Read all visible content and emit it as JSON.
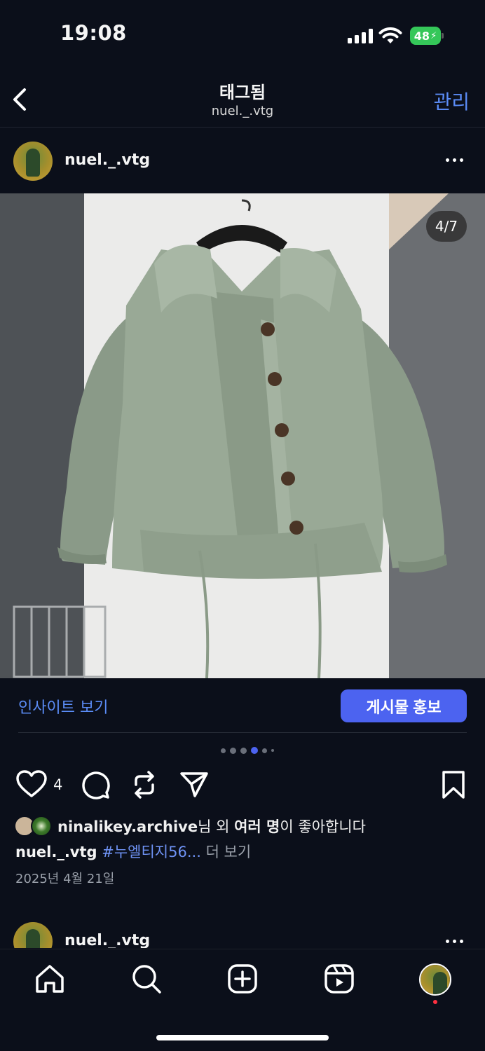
{
  "status_bar": {
    "time": "19:08",
    "battery": "48"
  },
  "header": {
    "title": "태그됨",
    "subtitle": "nuel._.vtg",
    "manage_label": "관리"
  },
  "post": {
    "username": "nuel._.vtg",
    "photo_counter": "4/7",
    "insight_label": "인사이트 보기",
    "promote_label": "게시물 홍보",
    "like_count": "4",
    "liked_by_user": "ninalikey.archive",
    "liked_by_suffix_1": "님 외 ",
    "liked_by_bold": "여러 명",
    "liked_by_suffix_2": "이 좋아합니다",
    "caption_user": "nuel._.vtg",
    "caption_hashtag": "#누엘티지56...",
    "caption_more": "더 보기",
    "date": "2025년 4월 21일"
  },
  "next_post": {
    "username": "nuel._.vtg"
  },
  "carousel": {
    "total": 6,
    "active_index": 3
  },
  "colors": {
    "accent": "#5b8cf7",
    "promote": "#4c63f0",
    "background": "#0b0f1a"
  },
  "icons": [
    "back-icon",
    "more-icon",
    "heart-icon",
    "comment-icon",
    "repost-icon",
    "share-icon",
    "bookmark-icon",
    "home-icon",
    "search-icon",
    "create-icon",
    "reels-icon"
  ]
}
